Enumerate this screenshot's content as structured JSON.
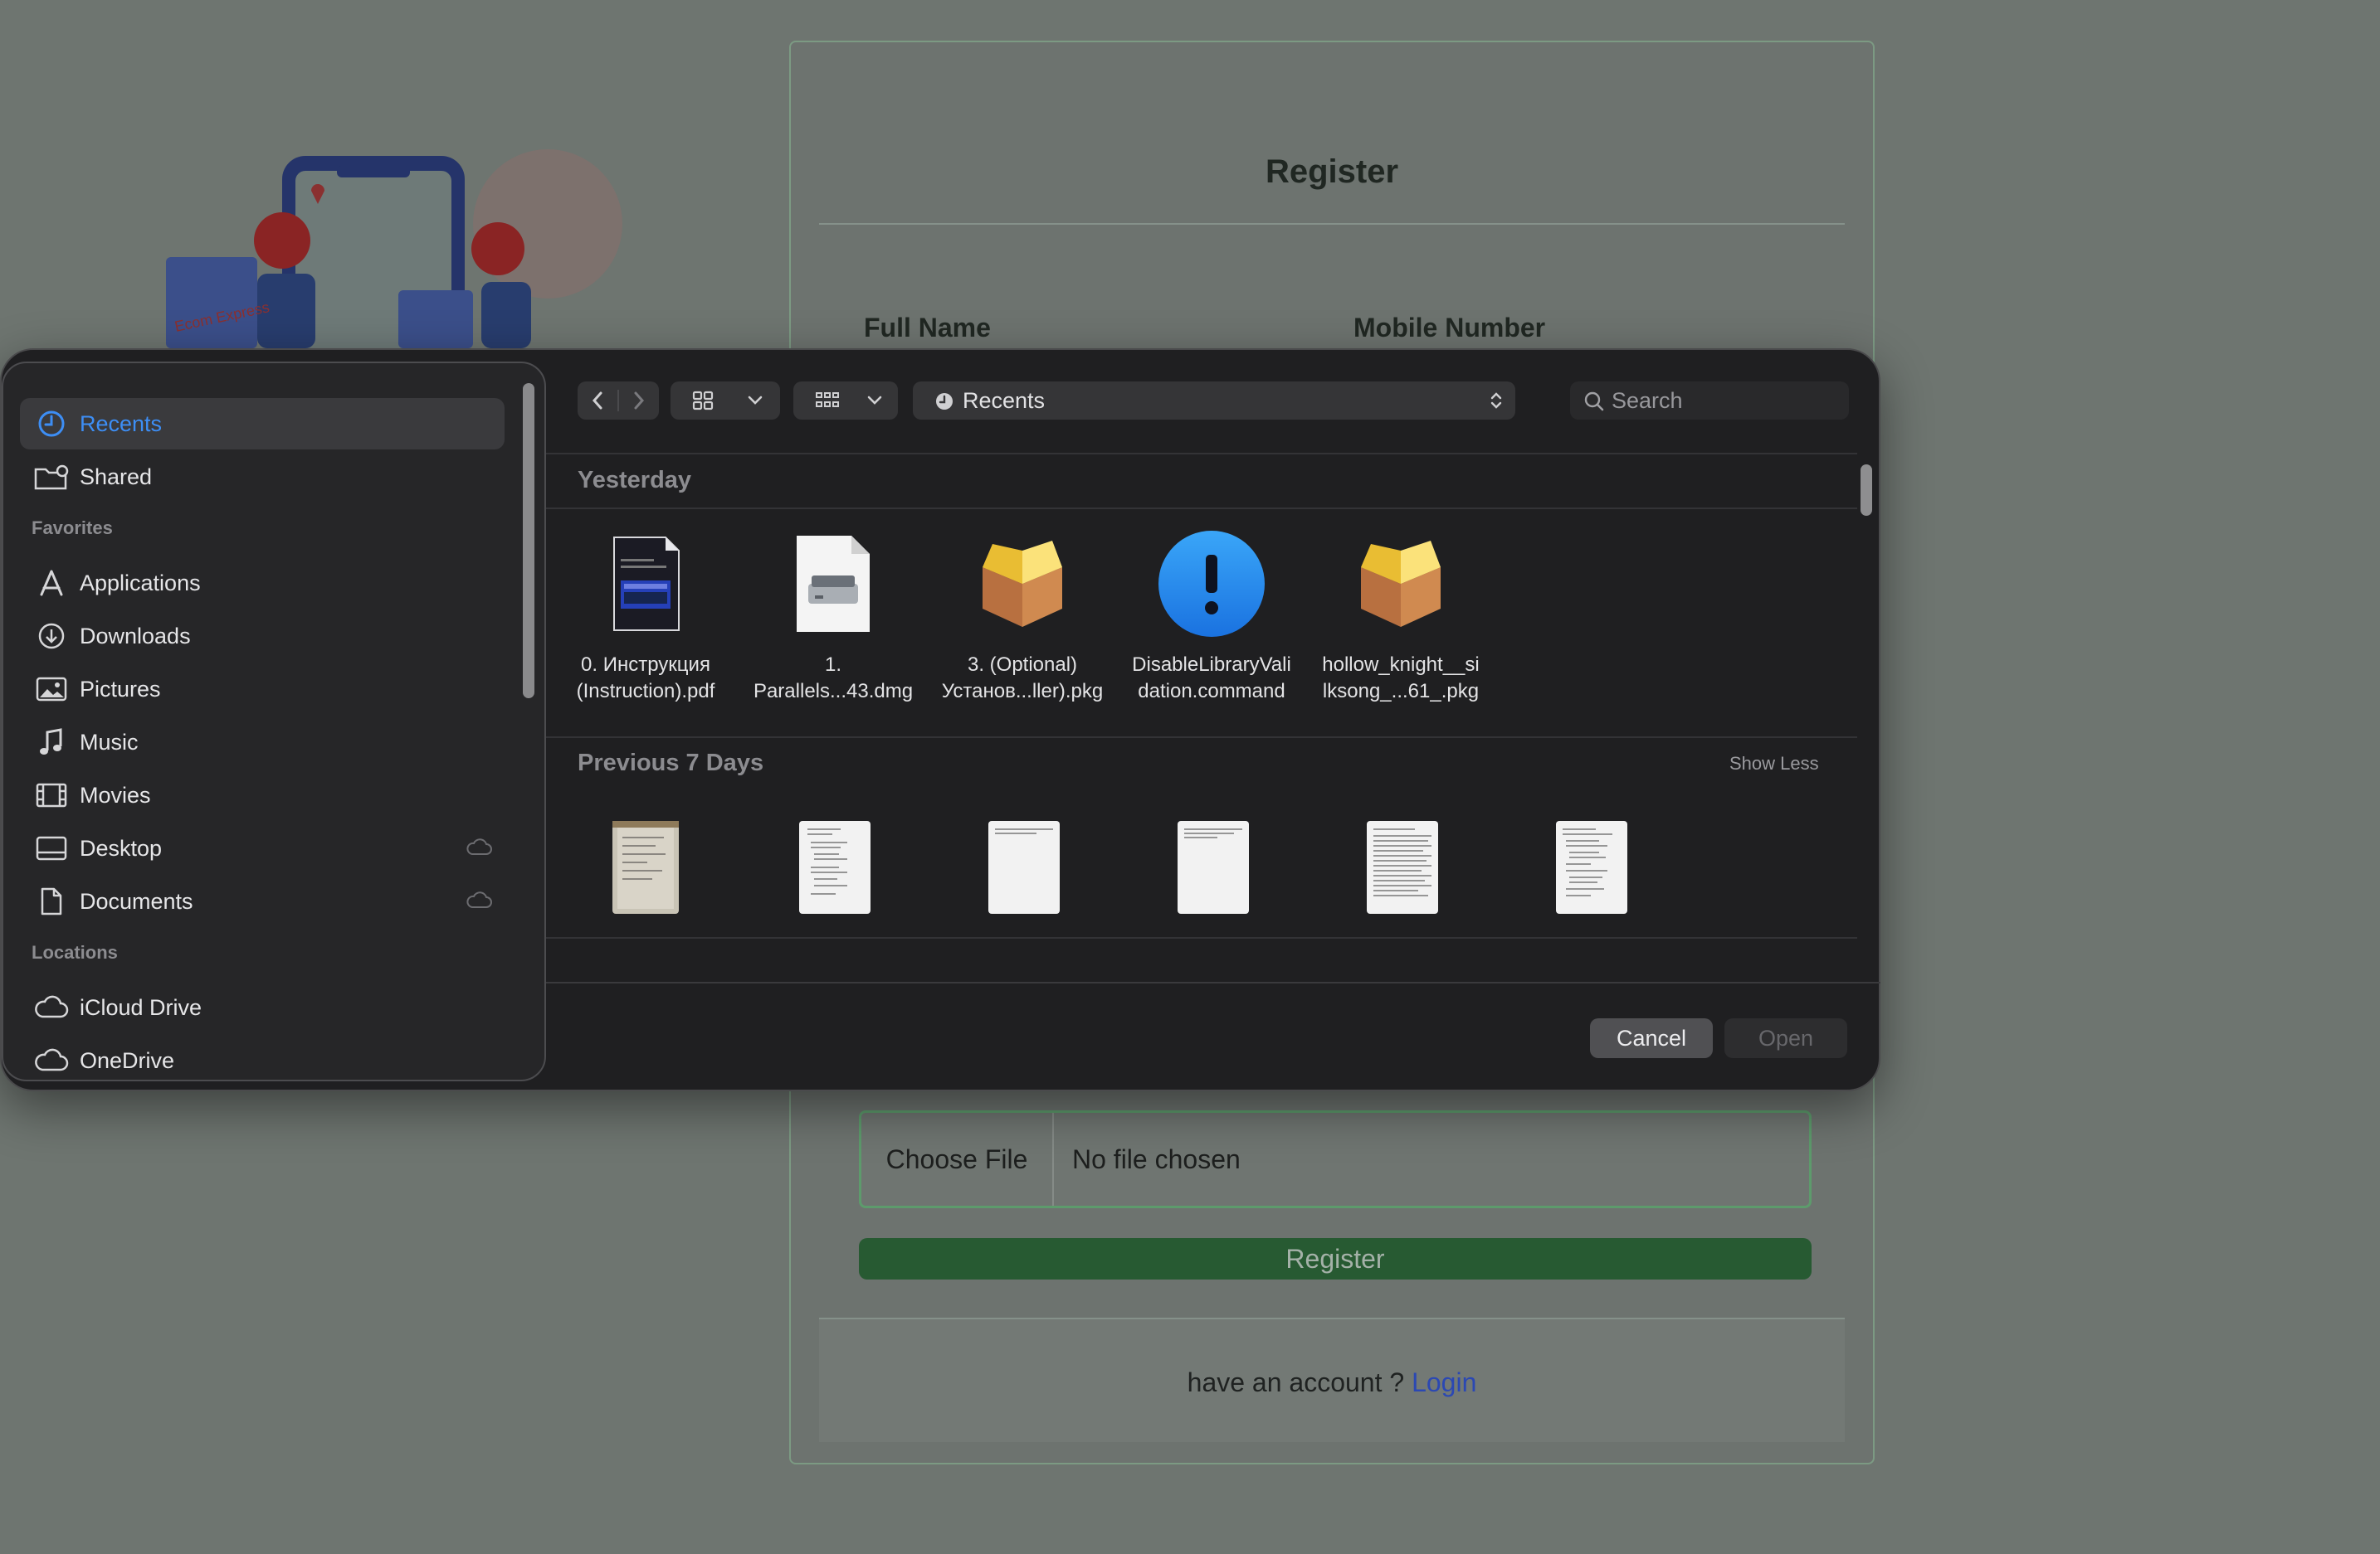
{
  "register": {
    "title": "Register",
    "full_name_label": "Full Name",
    "mobile_label": "Mobile Number",
    "choose_file": "Choose File",
    "no_file": "No file chosen",
    "submit_label": "Register",
    "footer_text": "have an account ? ",
    "login_link": "Login",
    "logo_text": "Ecom Express"
  },
  "dialog": {
    "sidebar": {
      "items": [
        {
          "label": "Recents",
          "icon": "clock-icon"
        },
        {
          "label": "Shared",
          "icon": "shared-folder-icon"
        }
      ],
      "favorites_title": "Favorites",
      "favorites": [
        {
          "label": "Applications",
          "icon": "applications-icon"
        },
        {
          "label": "Downloads",
          "icon": "downloads-icon"
        },
        {
          "label": "Pictures",
          "icon": "pictures-icon"
        },
        {
          "label": "Music",
          "icon": "music-icon"
        },
        {
          "label": "Movies",
          "icon": "movies-icon"
        },
        {
          "label": "Desktop",
          "icon": "desktop-icon"
        },
        {
          "label": "Documents",
          "icon": "documents-icon"
        }
      ],
      "locations_title": "Locations",
      "locations": [
        {
          "label": "iCloud Drive",
          "icon": "cloud-icon"
        },
        {
          "label": "OneDrive",
          "icon": "cloud-icon"
        }
      ]
    },
    "toolbar": {
      "path_label": "Recents",
      "search_placeholder": "Search"
    },
    "sections": {
      "yesterday": "Yesterday",
      "previous": "Previous 7 Days",
      "show_less": "Show Less"
    },
    "yesterday_files": [
      {
        "line1": "0. Инструкция",
        "line2": "(Instruction).pdf"
      },
      {
        "line1": "1.",
        "line2": "Parallels...43.dmg"
      },
      {
        "line1": "3. (Optional)",
        "line2": "Установ...ller).pkg"
      },
      {
        "line1": "DisableLibraryVali",
        "line2": "dation.command"
      },
      {
        "line1": "hollow_knight__si",
        "line2": "lksong_...61_.pkg"
      }
    ],
    "buttons": {
      "cancel": "Cancel",
      "open": "Open"
    }
  }
}
